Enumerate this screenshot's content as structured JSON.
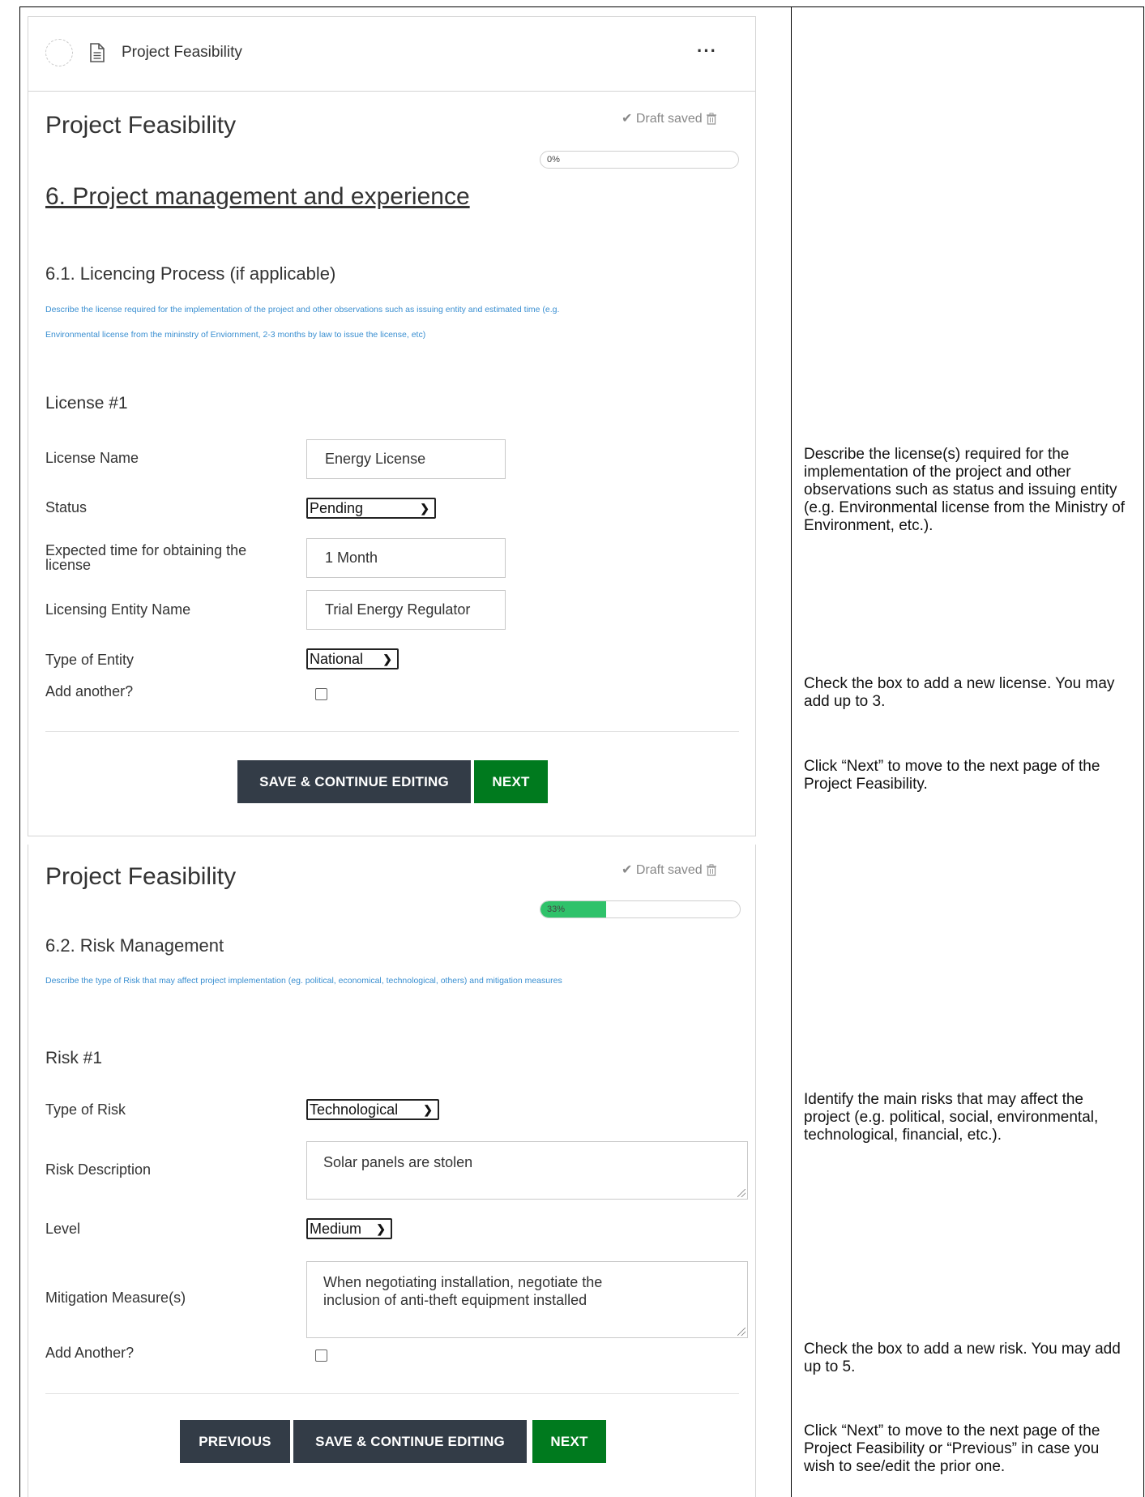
{
  "card_header": {
    "title": "Project Feasibility",
    "more_icon": "···"
  },
  "page1": {
    "form_title": "Project Feasibility",
    "draft_status": "✔ Draft saved",
    "progress_label": "0%",
    "progress_value": 0,
    "section_title": "6. Project management and experience",
    "subsection_title": "6.1. Licencing Process (if applicable)",
    "help_line1": "Describe the license required for the implementation of the project and other observations such as issuing entity and estimated time (e.g.",
    "help_line2": "Environmental license from the mininstry of Enviornment, 2-3 months by law to issue the license, etc)",
    "group_label": "License #1",
    "fields": {
      "license_name_label": "License Name",
      "license_name_value": "Energy License",
      "status_label": "Status",
      "status_value": "Pending",
      "expected_time_label_1": "Expected time for obtaining the",
      "expected_time_label_2": "license",
      "expected_time_value": "1 Month",
      "entity_name_label": "Licensing Entity Name",
      "entity_name_value": "Trial Energy Regulator",
      "entity_type_label": "Type of Entity",
      "entity_type_value": "National",
      "add_another_label": "Add another?"
    },
    "buttons": {
      "save": "SAVE & CONTINUE EDITING",
      "next": "NEXT"
    }
  },
  "page2": {
    "form_title": "Project Feasibility",
    "draft_status": "✔ Draft saved",
    "progress_label": "33%",
    "progress_value": 33,
    "subsection_title": "6.2. Risk Management",
    "help_line": "Describe the type of Risk that may affect project implementation (eg. political, economical, technological, others) and mitigation measures",
    "group_label": "Risk #1",
    "fields": {
      "risk_type_label": "Type of Risk",
      "risk_type_value": "Technological",
      "risk_desc_label": "Risk Description",
      "risk_desc_value": "Solar panels are stolen",
      "level_label": "Level",
      "level_value": "Medium",
      "mitigation_label": "Mitigation Measure(s)",
      "mitigation_value_1": "When negotiating installation, negotiate the",
      "mitigation_value_2": "inclusion of anti-theft equipment installed",
      "add_another_label": "Add Another?"
    },
    "buttons": {
      "previous": "PREVIOUS",
      "save": "SAVE & CONTINUE EDITING",
      "next": "NEXT"
    }
  },
  "notes": {
    "license_desc": "Describe the license(s) required for the implementation of the project and other observations such as status and issuing entity (e.g. Environmental license from the Ministry of Environment, etc.).",
    "add_license": "Check the box to add a new license. You may add up to 3.",
    "next_page": "Click “Next” to move to the next page of the Project Feasibility.",
    "risks_desc": "Identify the main risks that may affect the project (e.g. political, social, environmental, technological, financial, etc.).",
    "add_risk": "Check the box to add a new risk. You may add up to 5.",
    "next_prev": "Click “Next” to move to the next page of the Project Feasibility or “Previous” in case you wish to see/edit the prior one."
  },
  "colors": {
    "help_text": "#3a8fd1",
    "button_dark": "#333c47",
    "button_green": "#007a1e",
    "progress_fill": "#2fc26a"
  },
  "icons": {
    "header_status": "dashed-circle-icon",
    "header_doc": "document-icon",
    "more": "ellipsis-icon",
    "draft_trash": "trash-icon",
    "select_arrow": "chevron-down-icon"
  }
}
